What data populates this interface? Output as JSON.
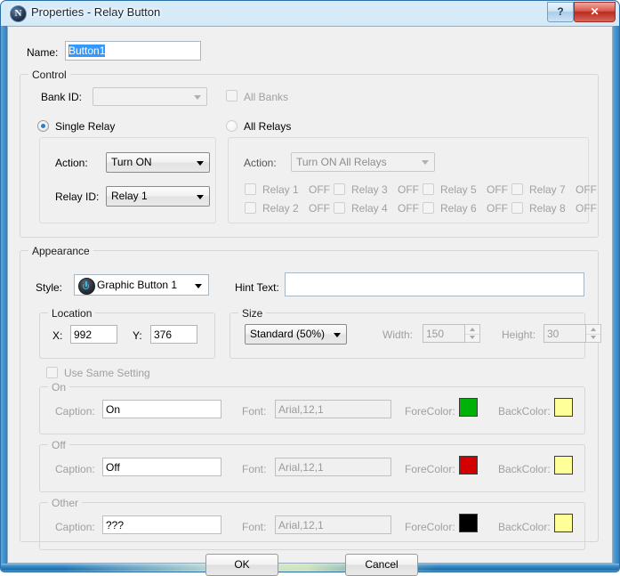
{
  "window": {
    "title": "Properties - Relay Button",
    "icon": "app-n-icon",
    "help_label": "?",
    "close_label": "✕"
  },
  "name_row": {
    "label": "Name:",
    "value": "Button1",
    "selected": true
  },
  "control": {
    "title": "Control",
    "bank_id": {
      "label": "Bank ID:",
      "value": "",
      "disabled": true
    },
    "all_banks": {
      "label": "All Banks",
      "checked": false,
      "disabled": true
    },
    "single_relay": {
      "label": "Single Relay",
      "selected": true,
      "action_label": "Action:",
      "action_value": "Turn ON",
      "relay_id_label": "Relay ID:",
      "relay_id_value": "Relay 1"
    },
    "all_relays": {
      "label": "All Relays",
      "selected": false,
      "disabled": true,
      "action_label": "Action:",
      "action_value": "Turn ON All Relays",
      "relays": [
        {
          "label": "Relay 1",
          "state": "OFF",
          "checked": false
        },
        {
          "label": "Relay 2",
          "state": "OFF",
          "checked": false
        },
        {
          "label": "Relay 3",
          "state": "OFF",
          "checked": false
        },
        {
          "label": "Relay 4",
          "state": "OFF",
          "checked": false
        },
        {
          "label": "Relay 5",
          "state": "OFF",
          "checked": false
        },
        {
          "label": "Relay 6",
          "state": "OFF",
          "checked": false
        },
        {
          "label": "Relay 7",
          "state": "OFF",
          "checked": false
        },
        {
          "label": "Relay 8",
          "state": "OFF",
          "checked": false
        }
      ]
    }
  },
  "appearance": {
    "title": "Appearance",
    "style": {
      "label": "Style:",
      "value": "Graphic Button 1",
      "icon": "power-button-icon"
    },
    "hint_text": {
      "label": "Hint Text:",
      "value": ""
    },
    "location": {
      "title": "Location",
      "x_label": "X:",
      "x_value": "992",
      "y_label": "Y:",
      "y_value": "376"
    },
    "size": {
      "title": "Size",
      "preset": "Standard   (50%)",
      "width_label": "Width:",
      "width_value": "150",
      "height_label": "Height:",
      "height_value": "30",
      "disabled": true
    },
    "use_same_setting": {
      "label": "Use Same Setting",
      "checked": false,
      "disabled": true
    },
    "states": [
      {
        "title": "On",
        "caption_label": "Caption:",
        "caption_value": "On",
        "font_label": "Font:",
        "font_value": "Arial,12,1",
        "forecolor_label": "ForeColor:",
        "forecolor": "#00B207",
        "backcolor_label": "BackColor:",
        "backcolor": "#FFFF99"
      },
      {
        "title": "Off",
        "caption_label": "Caption:",
        "caption_value": "Off",
        "font_label": "Font:",
        "font_value": "Arial,12,1",
        "forecolor_label": "ForeColor:",
        "forecolor": "#D40000",
        "backcolor_label": "BackColor:",
        "backcolor": "#FFFF99"
      },
      {
        "title": "Other",
        "caption_label": "Caption:",
        "caption_value": "???",
        "font_label": "Font:",
        "font_value": "Arial,12,1",
        "forecolor_label": "ForeColor:",
        "forecolor": "#000000",
        "backcolor_label": "BackColor:",
        "backcolor": "#FFFF99"
      }
    ]
  },
  "footer": {
    "ok_label": "OK",
    "cancel_label": "Cancel"
  }
}
